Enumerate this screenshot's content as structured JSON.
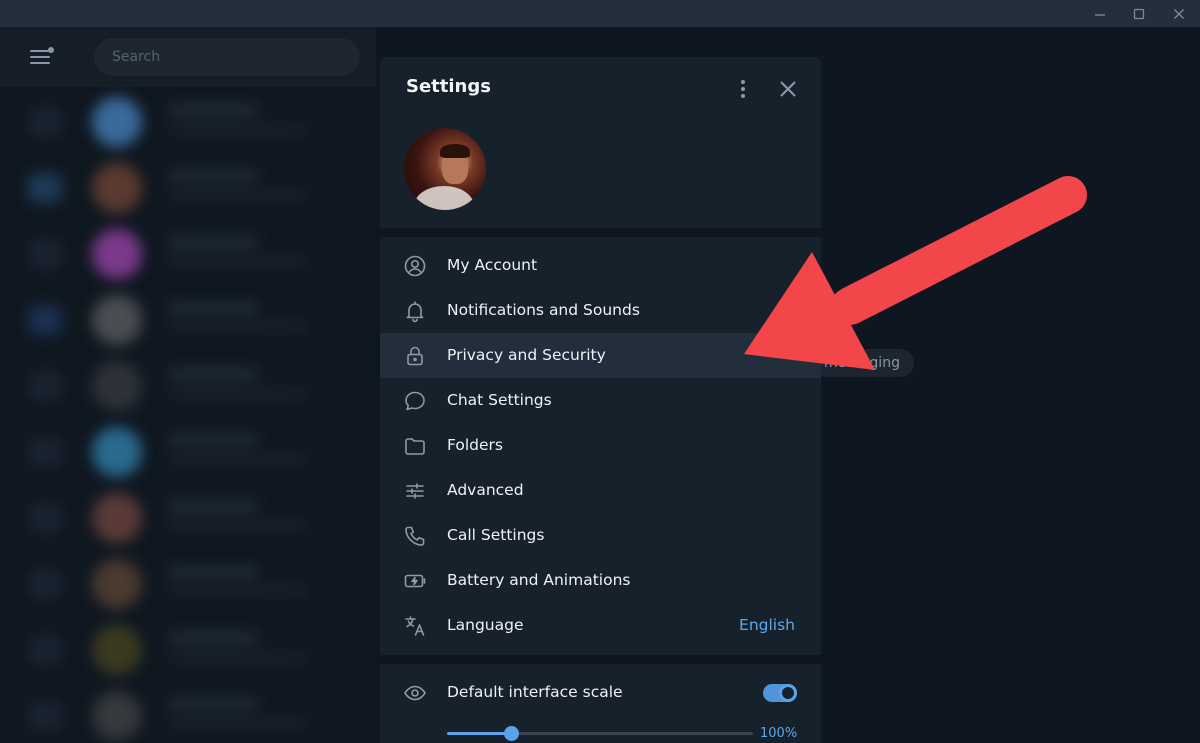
{
  "window": {
    "controls": [
      {
        "name": "minimize-button",
        "icon": "minimize-icon"
      },
      {
        "name": "maximize-button",
        "icon": "maximize-icon"
      },
      {
        "name": "close-window-button",
        "icon": "close-icon"
      }
    ]
  },
  "sidebar": {
    "menu_icon": "hamburger-menu-icon",
    "search": {
      "placeholder": "Search"
    }
  },
  "main": {
    "pill_text": "messaging"
  },
  "settings": {
    "title": "Settings",
    "more_icon": "more-vertical-icon",
    "close_icon": "close-icon",
    "menu": [
      {
        "label": "My Account",
        "icon": "account-circle-icon"
      },
      {
        "label": "Notifications and Sounds",
        "icon": "bell-icon"
      },
      {
        "label": "Privacy and Security",
        "icon": "lock-icon"
      },
      {
        "label": "Chat Settings",
        "icon": "chat-bubble-icon"
      },
      {
        "label": "Folders",
        "icon": "folder-icon"
      },
      {
        "label": "Advanced",
        "icon": "sliders-icon"
      },
      {
        "label": "Call Settings",
        "icon": "phone-icon"
      },
      {
        "label": "Battery and Animations",
        "icon": "battery-bolt-icon"
      },
      {
        "label": "Language",
        "icon": "translate-icon",
        "value": "English"
      }
    ],
    "scale": {
      "label": "Default interface scale",
      "icon": "eye-icon",
      "toggle_on": true,
      "value_label": "100%",
      "slider_fraction": 0.21
    }
  },
  "colors": {
    "accent": "#5ea8e8",
    "arrow": "#f2464b",
    "panel": "#17212b",
    "background": "#0e1621"
  }
}
